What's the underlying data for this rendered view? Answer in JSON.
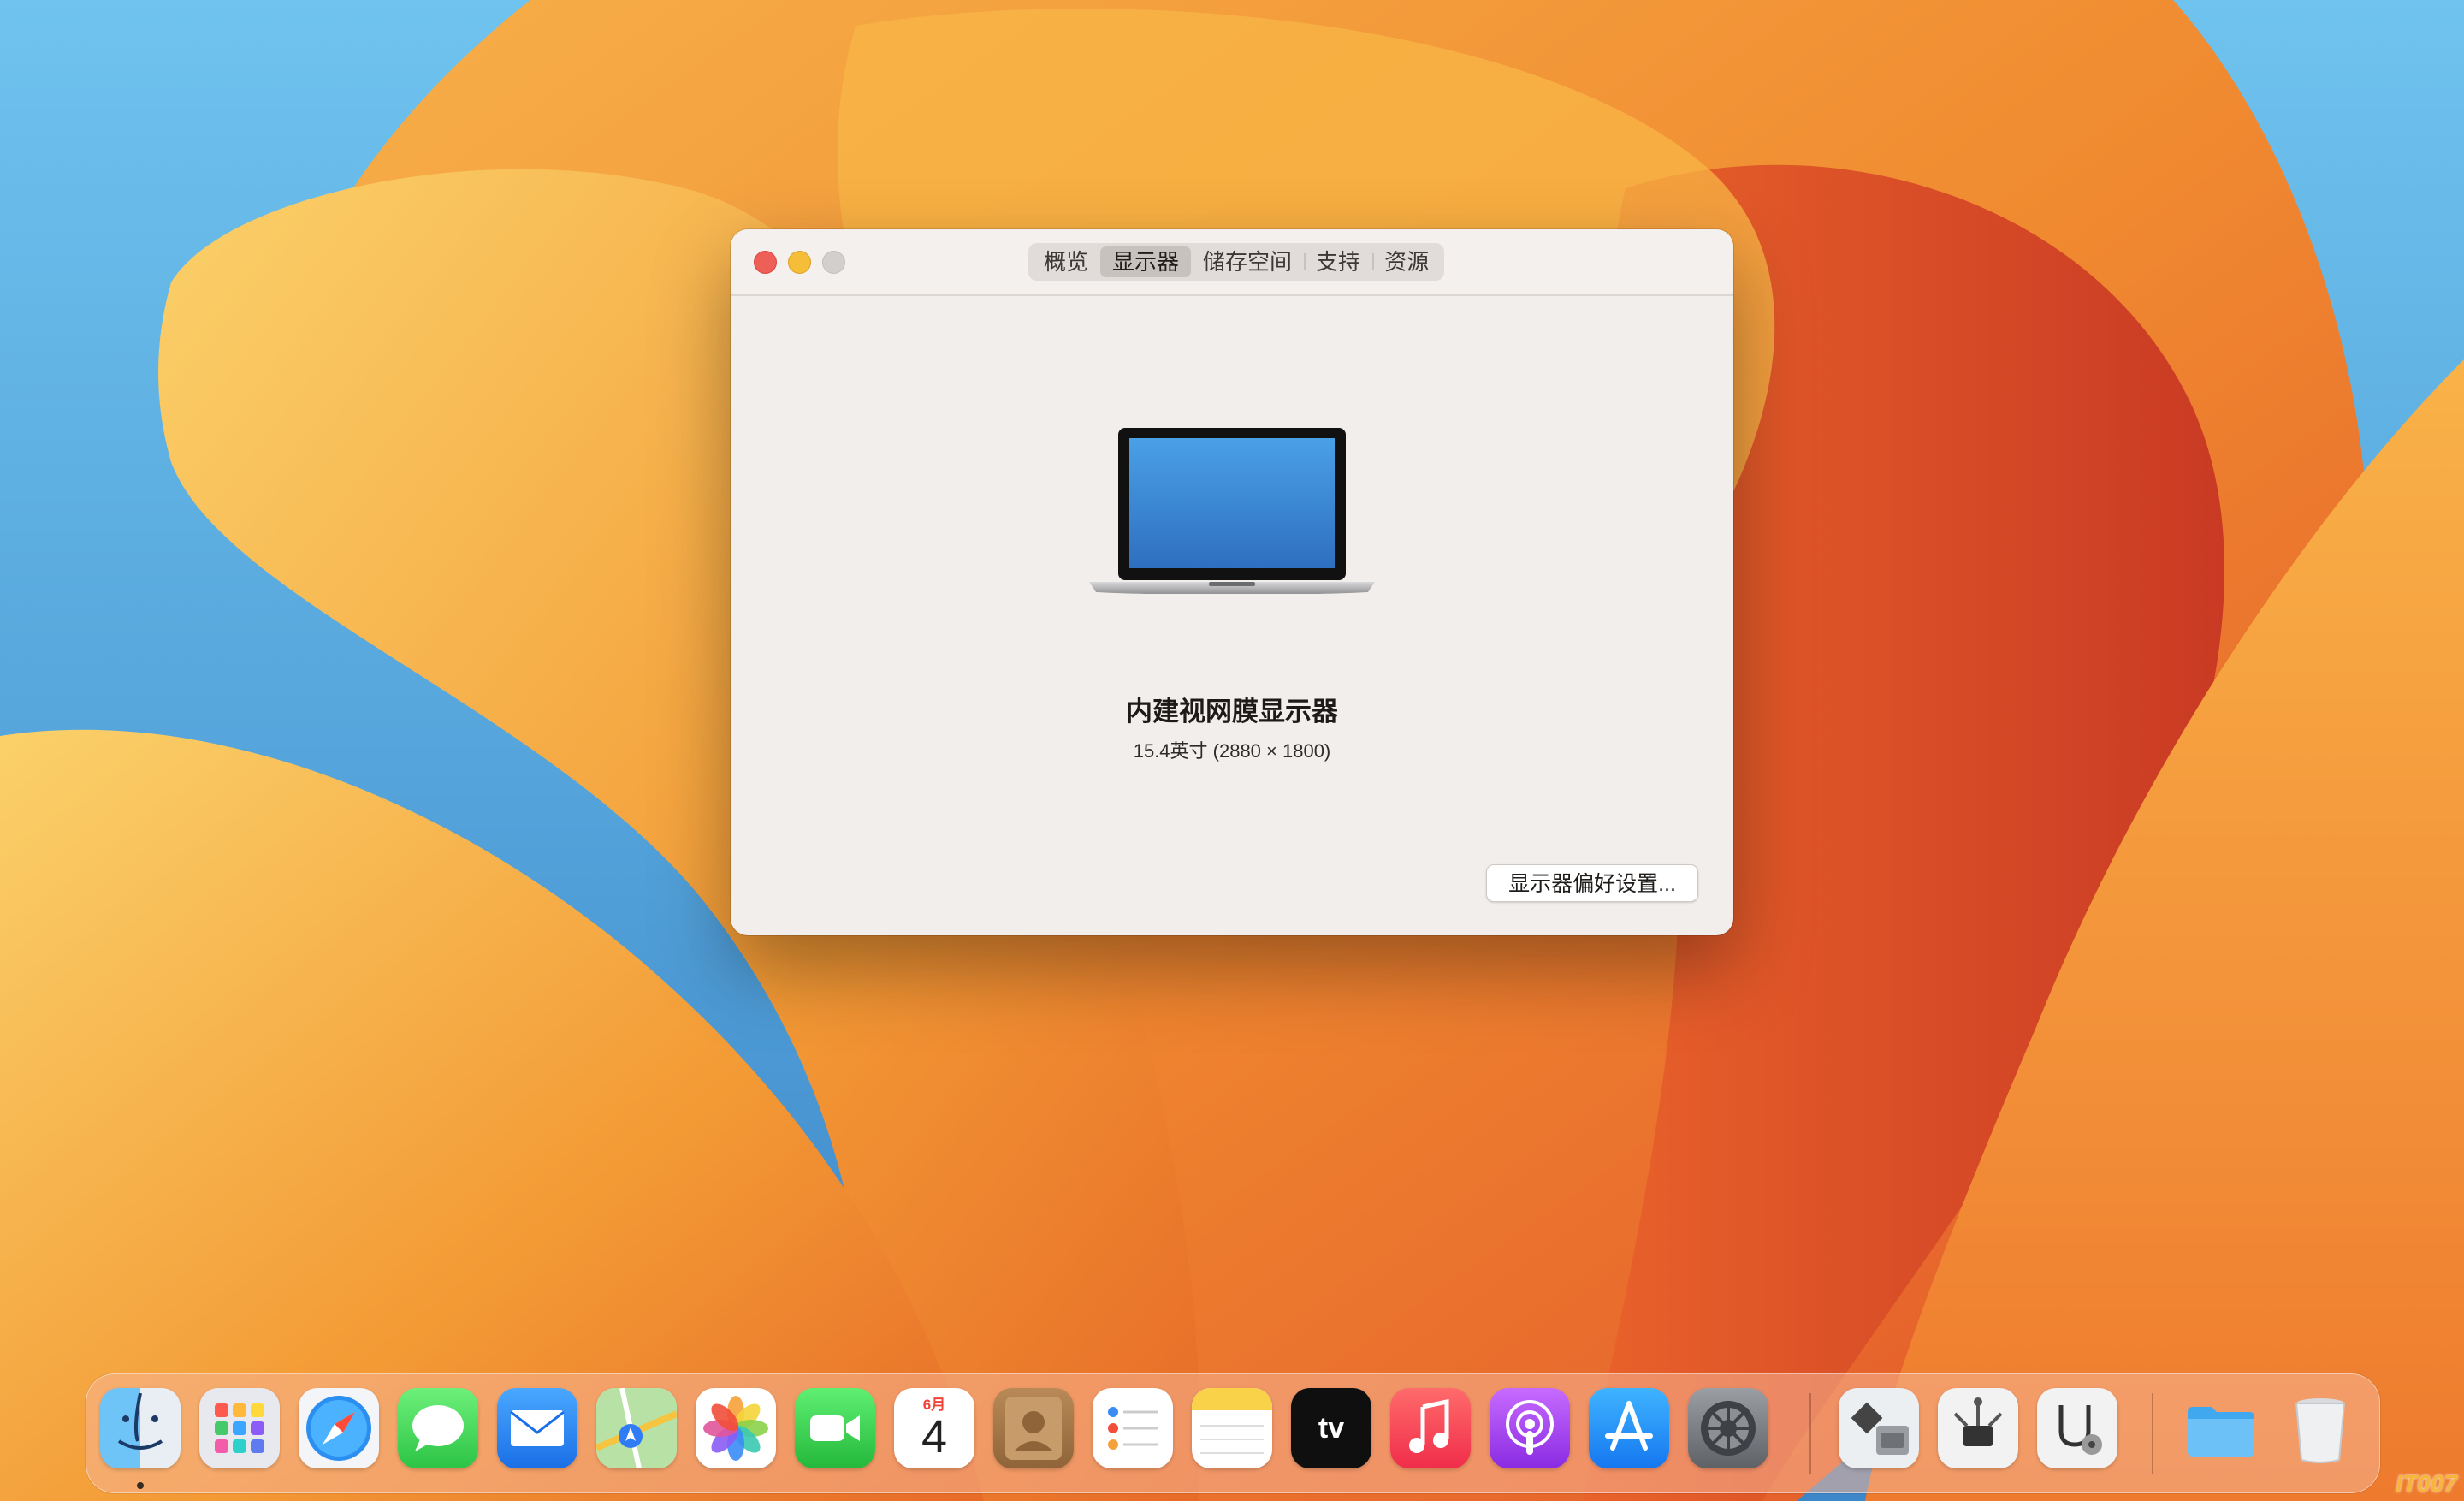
{
  "window": {
    "tabs": [
      {
        "label": "概览",
        "active": false
      },
      {
        "label": "显示器",
        "active": true
      },
      {
        "label": "储存空间",
        "active": false
      },
      {
        "label": "支持",
        "active": false
      },
      {
        "label": "资源",
        "active": false
      }
    ],
    "display_name": "内建视网膜显示器",
    "display_spec": "15.4英寸 (2880 × 1800)",
    "prefs_button": "显示器偏好设置..."
  },
  "dock": {
    "calendar": {
      "month": "6月",
      "day": "4"
    },
    "tv_label": "tv",
    "apps": [
      "finder",
      "launchpad",
      "safari",
      "messages",
      "mail",
      "maps",
      "photos",
      "facetime",
      "calendar",
      "contacts",
      "reminders",
      "notes",
      "apple-tv",
      "music",
      "podcasts",
      "app-store",
      "system-settings",
      "boot-camp-assistant",
      "system-information",
      "disk-utility",
      "folder",
      "trash"
    ]
  },
  "watermark": "IT007",
  "colors": {
    "close": "#ee5f57",
    "minimize": "#f5bd38",
    "zoom_disabled": "#d3cfcc",
    "window_bg": "#f2eeeb"
  }
}
